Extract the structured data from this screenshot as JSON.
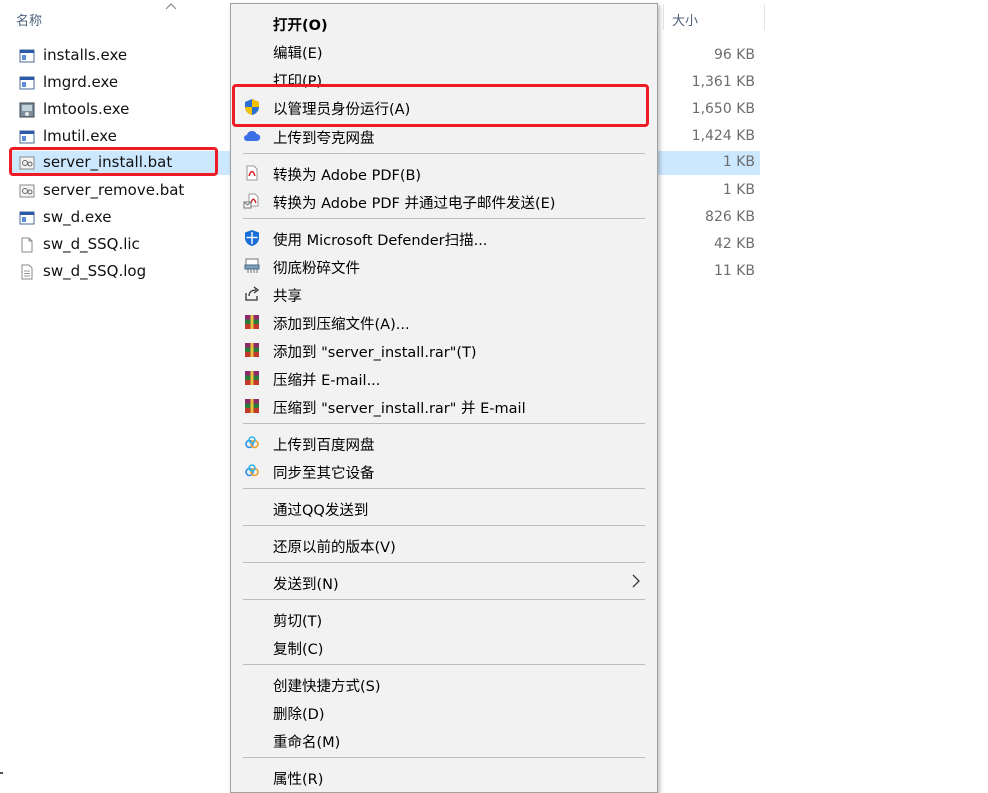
{
  "header": {
    "name_col": "名称",
    "size_col": "大小"
  },
  "files": [
    {
      "name": "installs.exe",
      "size": "96 KB",
      "icon": "exe-icon"
    },
    {
      "name": "lmgrd.exe",
      "size": "1,361 KB",
      "icon": "exe-icon"
    },
    {
      "name": "lmtools.exe",
      "size": "1,650 KB",
      "icon": "tools-icon"
    },
    {
      "name": "lmutil.exe",
      "size": "1,424 KB",
      "icon": "exe-icon"
    },
    {
      "name": "server_install.bat",
      "size": "1 KB",
      "icon": "bat-icon",
      "selected": true
    },
    {
      "name": "server_remove.bat",
      "size": "1 KB",
      "icon": "bat-icon"
    },
    {
      "name": "sw_d.exe",
      "size": "826 KB",
      "icon": "exe-icon"
    },
    {
      "name": "sw_d_SSQ.lic",
      "size": "42 KB",
      "icon": "document-icon"
    },
    {
      "name": "sw_d_SSQ.log",
      "size": "11 KB",
      "icon": "text-file-icon"
    }
  ],
  "menu": {
    "open": "打开(O)",
    "edit": "编辑(E)",
    "print": "打印(P)",
    "run_as_admin": "以管理员身份运行(A)",
    "upload_quark": "上传到夸克网盘",
    "convert_pdf": "转换为 Adobe PDF(B)",
    "convert_pdf_email": "转换为 Adobe PDF 并通过电子邮件发送(E)",
    "defender_scan": "使用 Microsoft Defender扫描...",
    "shred": "彻底粉碎文件",
    "share": "共享",
    "add_archive": "添加到压缩文件(A)...",
    "add_named_rar": "添加到 \"server_install.rar\"(T)",
    "compress_email": "压缩并 E-mail...",
    "compress_rar_email": "压缩到 \"server_install.rar\" 并 E-mail",
    "upload_baidu": "上传到百度网盘",
    "sync_devices": "同步至其它设备",
    "send_qq": "通过QQ发送到",
    "restore_versions": "还原以前的版本(V)",
    "send_to": "发送到(N)",
    "cut": "剪切(T)",
    "copy": "复制(C)",
    "create_shortcut": "创建快捷方式(S)",
    "delete": "删除(D)",
    "rename": "重命名(M)",
    "properties": "属性(R)"
  },
  "colors": {
    "selection": "#cce8ff",
    "highlight_box": "#ee1c25",
    "menu_bg": "#f2f2f2"
  }
}
